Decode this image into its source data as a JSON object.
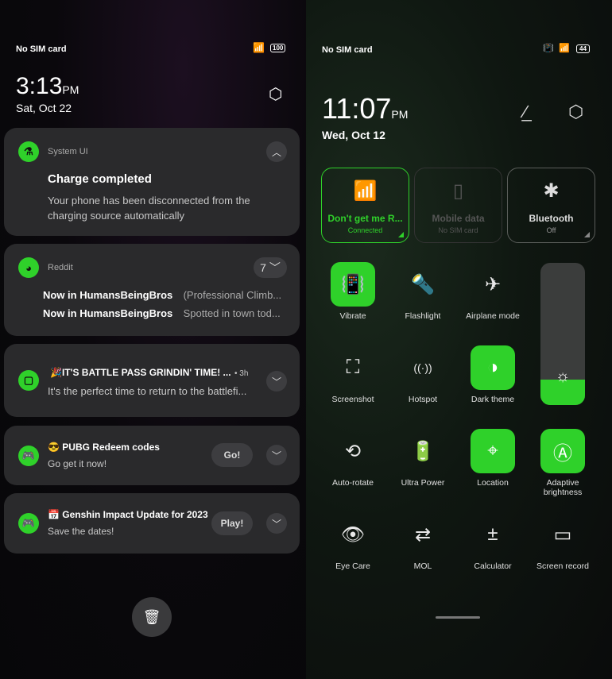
{
  "left": {
    "status": {
      "carrier": "No SIM card",
      "battery": "100"
    },
    "clock": {
      "time": "3:13",
      "ampm": "PM",
      "date": "Sat, Oct 22"
    },
    "notifications": [
      {
        "app": "System UI",
        "title": "Charge completed",
        "body": "Your phone has been disconnected from the charging source automatically"
      },
      {
        "app": "Reddit",
        "count": "7",
        "lines": [
          {
            "title": "Now in HumansBeingBros",
            "text": "(Professional Climb..."
          },
          {
            "title": "Now in HumansBeingBros",
            "text": "Spotted in town tod..."
          }
        ]
      },
      {
        "title": "🎉IT'S BATTLE PASS GRINDIN' TIME! ...",
        "time": "• 3h",
        "body": "It's the perfect time to return to the battlefi..."
      },
      {
        "title": "😎 PUBG Redeem codes",
        "body": "Go get it now!",
        "action": "Go!"
      },
      {
        "title": "📅 Genshin Impact Update for 2023",
        "body": "Save the dates!",
        "action": "Play!"
      }
    ]
  },
  "right": {
    "status": {
      "carrier": "No SIM card",
      "battery": "44"
    },
    "clock": {
      "time": "11:07",
      "ampm": "PM",
      "date": "Wed, Oct 12"
    },
    "tiles": [
      {
        "label": "Don't get me R...",
        "sub": "Connected",
        "state": "on"
      },
      {
        "label": "Mobile data",
        "sub": "No SIM card",
        "state": "disabled"
      },
      {
        "label": "Bluetooth",
        "sub": "Off",
        "state": "off"
      }
    ],
    "toggles": [
      {
        "label": "Vibrate",
        "on": true
      },
      {
        "label": "Flashlight",
        "on": false
      },
      {
        "label": "Airplane mode",
        "on": false
      },
      {
        "label": "Screenshot",
        "on": false
      },
      {
        "label": "Hotspot",
        "on": false
      },
      {
        "label": "Dark theme",
        "on": true
      },
      {
        "label": "Auto-rotate",
        "on": false
      },
      {
        "label": "Ultra Power",
        "on": false
      },
      {
        "label": "Location",
        "on": true
      },
      {
        "label": "Adaptive brightness",
        "on": true
      },
      {
        "label": "Eye Care",
        "on": false
      },
      {
        "label": "MOL",
        "on": false
      },
      {
        "label": "Calculator",
        "on": false
      },
      {
        "label": "Screen record",
        "on": false
      }
    ],
    "brightness_percent": 18
  },
  "colors": {
    "accent": "#2fd12a",
    "card": "#2a2a2c"
  }
}
